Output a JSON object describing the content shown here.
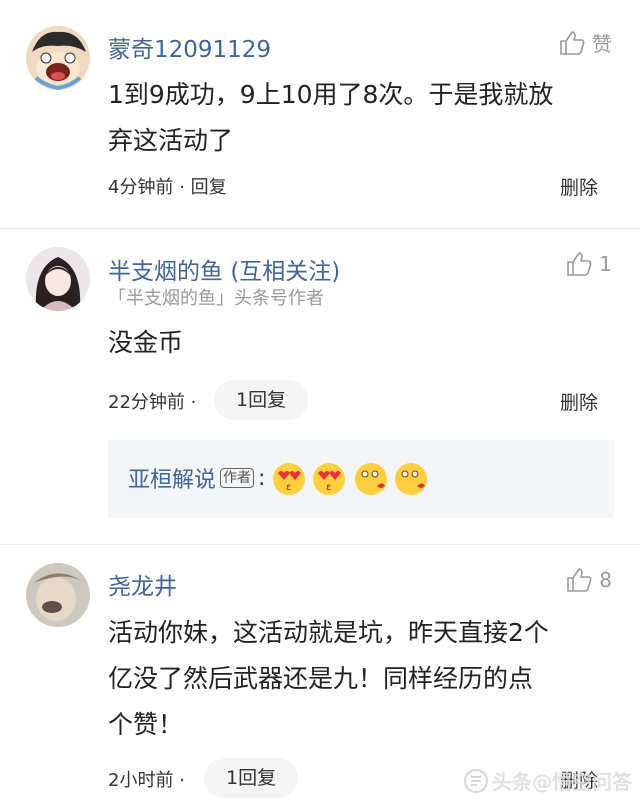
{
  "comments": [
    {
      "username": "蒙奇12091129",
      "like_label": "赞",
      "content": "1到9成功，9上10用了8次。于是我就放弃这活动了",
      "content_lines": [
        "1到9成功，9上10用了8次。于是我就放",
        "弃这活动了"
      ],
      "time": "4分钟前",
      "reply_label": "回复",
      "delete_label": "删除"
    },
    {
      "username": "半支烟的鱼",
      "relation": "(互相关注)",
      "subtitle": "「半支烟的鱼」头条号作者",
      "like_count": "1",
      "content": "没金币",
      "time": "22分钟前 ·",
      "reply_pill": "1回复",
      "delete_label": "删除",
      "reply_preview": {
        "name": "亚桓解说",
        "badge": "作者",
        "colon": ":",
        "emojis": [
          "heart-eyes-emoji",
          "heart-eyes-emoji",
          "kiss-emoji",
          "kiss-emoji"
        ]
      }
    },
    {
      "username": "尧龙井",
      "like_count": "8",
      "content": "活动你妹，这活动就是坑，昨天直接2个亿没了然后武器还是九！同样经历的点个赞！",
      "content_lines": [
        "活动你妹，这活动就是坑，昨天直接2个",
        "亿没了然后武器还是九！同样经历的点",
        "个赞！"
      ],
      "time": "2小时前 ·",
      "reply_pill": "1回复",
      "delete_label": "删除"
    }
  ],
  "watermark": "头条@悟空问答",
  "colors": {
    "username": "#406599",
    "background": "#ffffff",
    "quote_bg": "#f4f5f6"
  }
}
